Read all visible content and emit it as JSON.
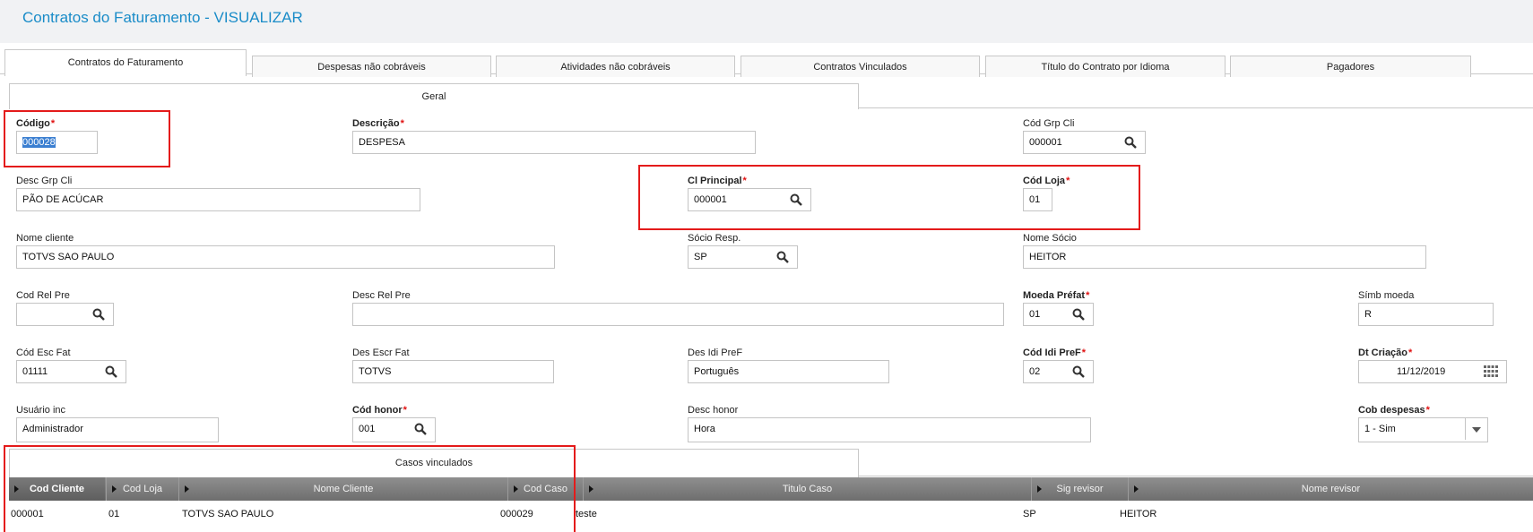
{
  "page": {
    "title": "Contratos do Faturamento - VISUALIZAR"
  },
  "tabs": [
    {
      "label": "Contratos do Faturamento"
    },
    {
      "label": "Despesas não cobráveis"
    },
    {
      "label": "Atividades não cobráveis"
    },
    {
      "label": "Contratos Vinculados"
    },
    {
      "label": "Título do Contrato por Idioma"
    },
    {
      "label": "Pagadores"
    }
  ],
  "subtabs": {
    "geral": "Geral",
    "casos": "Casos vinculados"
  },
  "form": {
    "codigo": {
      "label": "Código",
      "value": "000028"
    },
    "descricao": {
      "label": "Descrição",
      "value": "DESPESA"
    },
    "cod_grp_cli": {
      "label": "Cód Grp Cli",
      "value": "000001"
    },
    "desc_grp_cli": {
      "label": "Desc Grp Cli",
      "value": "PÃO DE ACÚCAR"
    },
    "cl_principal": {
      "label": "Cl Principal",
      "value": "000001"
    },
    "cod_loja": {
      "label": "Cód Loja",
      "value": "01"
    },
    "nome_cliente": {
      "label": "Nome cliente",
      "value": "TOTVS SAO PAULO"
    },
    "socio_resp": {
      "label": "Sócio Resp.",
      "value": "SP"
    },
    "nome_socio": {
      "label": "Nome Sócio",
      "value": "HEITOR"
    },
    "cod_rel_pre": {
      "label": "Cod Rel Pre",
      "value": ""
    },
    "desc_rel_pre": {
      "label": "Desc Rel Pre",
      "value": ""
    },
    "moeda_prefat": {
      "label": "Moeda Préfat",
      "value": "01"
    },
    "simb_moeda": {
      "label": "Símb moeda",
      "value": "R"
    },
    "cod_esc_fat": {
      "label": "Cód Esc Fat",
      "value": "01111"
    },
    "des_escr_fat": {
      "label": "Des Escr Fat",
      "value": "TOTVS"
    },
    "des_idi_pref": {
      "label": "Des Idi PreF",
      "value": "Português"
    },
    "cod_idi_pref": {
      "label": "Cód Idi PreF",
      "value": "02"
    },
    "dt_criacao": {
      "label": "Dt Criação",
      "value": "11/12/2019"
    },
    "usuario_inc": {
      "label": "Usuário inc",
      "value": "Administrador"
    },
    "cod_honor": {
      "label": "Cód honor",
      "value": "001"
    },
    "desc_honor": {
      "label": "Desc honor",
      "value": "Hora"
    },
    "cob_despesas": {
      "label": "Cob despesas",
      "value": "1 - Sim"
    }
  },
  "grid": {
    "columns": [
      "Cod Cliente",
      "Cod Loja",
      "Nome Cliente",
      "Cod Caso",
      "Titulo Caso",
      "Sig revisor",
      "Nome revisor"
    ],
    "rows": [
      [
        "000001",
        "01",
        "TOTVS SAO PAULO",
        "000029",
        "teste",
        "SP",
        "HEITOR"
      ]
    ]
  },
  "colors": {
    "accent": "#1a8cc8",
    "required": "#e01010",
    "highlight": "#e41b1b"
  }
}
